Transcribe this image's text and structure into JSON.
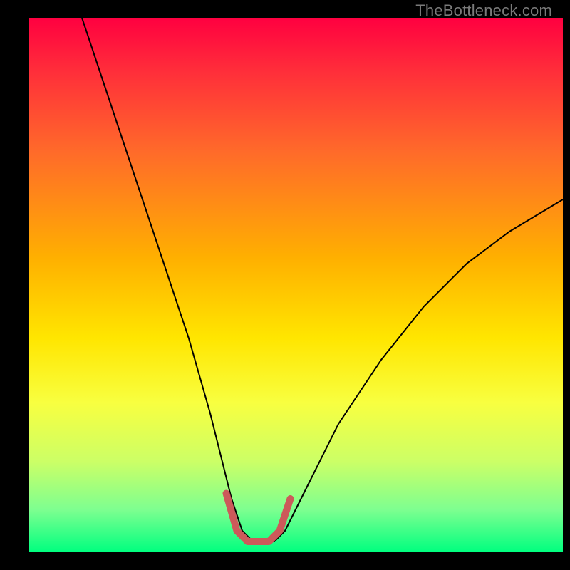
{
  "watermark": "TheBottleneck.com",
  "chart_data": {
    "type": "line",
    "title": "",
    "xlabel": "",
    "ylabel": "",
    "xlim": [
      0,
      100
    ],
    "ylim": [
      0,
      100
    ],
    "grid": false,
    "legend": false,
    "series": [
      {
        "name": "bottleneck-curve",
        "color": "#000000",
        "stroke_width": 2,
        "x": [
          10,
          14,
          18,
          22,
          26,
          30,
          34,
          36,
          38,
          40,
          42,
          44,
          46,
          48,
          50,
          54,
          58,
          66,
          74,
          82,
          90,
          100
        ],
        "y": [
          100,
          88,
          76,
          64,
          52,
          40,
          26,
          18,
          10,
          4,
          2,
          2,
          2,
          4,
          8,
          16,
          24,
          36,
          46,
          54,
          60,
          66
        ]
      },
      {
        "name": "optimal-zone",
        "color": "#cc5a5a",
        "stroke_width": 10,
        "linecap": "round",
        "x": [
          37,
          39,
          41,
          43,
          45,
          47,
          49
        ],
        "y": [
          11,
          4,
          2,
          2,
          2,
          4,
          10
        ]
      }
    ]
  }
}
